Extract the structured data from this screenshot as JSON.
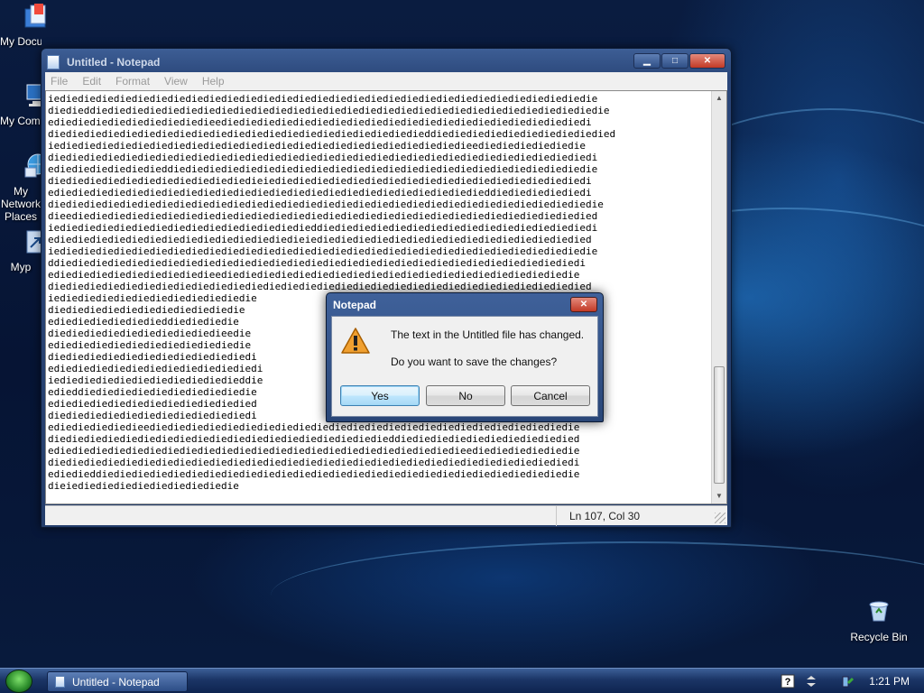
{
  "desktop": {
    "icons": [
      {
        "label": "My Documents"
      },
      {
        "label": "My Computer"
      },
      {
        "label": "My Network Places"
      },
      {
        "label": "Myp"
      },
      {
        "label": "Recycle Bin"
      }
    ]
  },
  "notepad": {
    "title": "Untitled - Notepad",
    "menu": [
      "File",
      "Edit",
      "Format",
      "View",
      "Help"
    ],
    "lines": [
      "iediediediediediediediediediediediediediediediediediediediediediediediediediediediediediedie",
      "diedieddiediediediediediediediediediediediediediediediediediediediediediediediediediediediedie",
      "ediediediediediediediediedieediediediediediediediediediediediediediediediediediediediediedi",
      "diediediediediediediediediediediediediediediediediediediediedieddiediediediediediediediediedied",
      "iediediediediediediediediediediediediediediediediediediediediediediedieediediediediediedie",
      "diediediediediediediediediediediediediediediediediediediediediediediediediediediediediediedi",
      "ediediediediediedieddiediediediediediediediediediediediediediediediediediediediediediediedie",
      "diediediediediediediediediediediedieiediediediediediediediediediediediediediediediediediedi",
      "ediediediediediediediediediediediediediediediediediediediediediediediedieddiediediediediedi",
      "diediediediediediediediediediediediediediediediediediediediediediediediediediediediediediedie",
      "dieediediediediediediediediediediediediediediediediediediediediediediediediediediediediedied",
      "iediediediediediediediediediediediediediedieddiediediediediediediediediediediediediediediedi",
      "ediediediediediediediediediediediediediedieiediediediediediediediediediediediediediediedied",
      "iediediediediediediediediediediediediediediediediediediediediediediediediediediediediediedie",
      "ddiediediediediediediediediediediediediediediediediediediediediediediediediediediediediedi",
      "ediediediediediediediediedieediediediediediediediediediediediediediediediediediediediedie",
      "diediediediediediediediediediediediediediediediediediediediediediediediediediediediediedied",
      "iediediediediediediediediediediedie",
      "diediediediediediediediediediedie",
      "ediediediediediedieddiediediedie",
      "diediediediediediediediediedieedie",
      "ediediediediediediediediediediedie",
      "diediediediediediediediediediediedi",
      "ediediediediediediediediediediediedi",
      "iediediediediediediediediediedieddie",
      "edieddiediediediediediediediediedie",
      "ediediediediediediediediediediedied",
      "diediediediediediediediediediediedi",
      "ediediediediedieediediediediediediediediediediediediediediediediediediediediediediediedie",
      "diediediediediediediediediediediediediediediediediediedieddiediediediediediediediediedied",
      "ediediediediediediediediediediediediediediediediediediediediediediedieediediediediediedie",
      "diediediediediediediediediediediediediediediediediediediediediediediediediediediediediedi",
      "ediedieddiediediediediediediediediediediediediediediediediediediediediediediediediediedie",
      "dieiediediediediediediediediedie"
    ],
    "status": "Ln 107, Col 30"
  },
  "dialog": {
    "title": "Notepad",
    "message": "The text in the Untitled file has changed.",
    "question": "Do you want to save the changes?",
    "buttons": {
      "yes": "Yes",
      "no": "No",
      "cancel": "Cancel"
    }
  },
  "taskbar": {
    "task_label": "Untitled - Notepad",
    "clock": "1:21 PM"
  },
  "colors": {
    "accent": "#294677",
    "desktop_bg": "#061434",
    "warning": "#f0a030"
  }
}
